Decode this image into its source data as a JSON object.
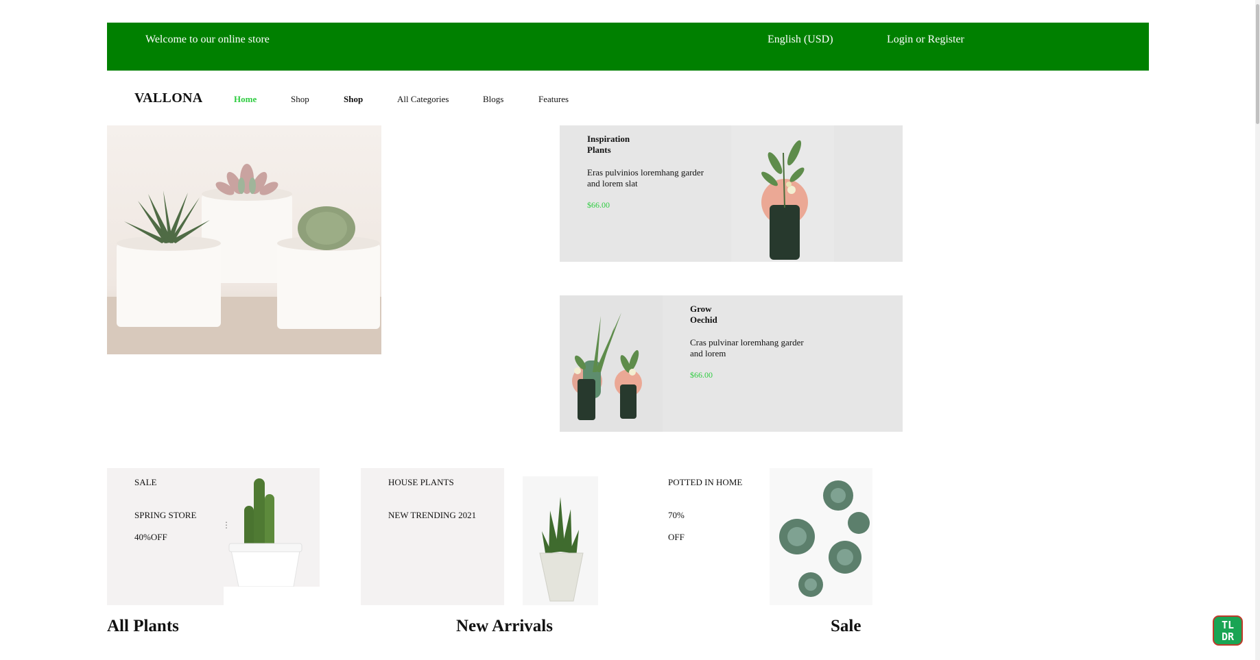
{
  "topbar": {
    "welcome": "Welcome to our online store",
    "language": "English (USD)",
    "login": "Login or Register",
    "color": "#008000"
  },
  "nav": {
    "logo": "VALLONA",
    "items": [
      {
        "label": "Home",
        "active": true
      },
      {
        "label": "Shop"
      },
      {
        "label": "Shop"
      },
      {
        "label": "All Categories"
      },
      {
        "label": "Blogs"
      },
      {
        "label": "Features"
      }
    ],
    "active_color": "#2ecc40"
  },
  "hero": {
    "image": "succulents-in-white-pots"
  },
  "promos": [
    {
      "title_line1": "Inspiration",
      "title_line2": "Plants",
      "desc_line1": "Eras pulvinios loremhang garder",
      "desc_line2": "and lorem slat",
      "price": "$66.00",
      "image": "plant-in-dark-vase"
    },
    {
      "title_line1": "Grow",
      "title_line2": "Oechid",
      "desc_line1": "Cras pulvinar loremhang garder",
      "desc_line2": "and lorem",
      "price": "$66.00",
      "image": "two-plants-in-vases"
    }
  ],
  "banners": [
    {
      "line1": "SALE",
      "line2": "SPRING STORE",
      "line3": "40%OFF",
      "image": "cactus-in-white-pot"
    },
    {
      "line1": "HOUSE PLANTS",
      "line2": "NEW TRENDING 2021",
      "image": "succulent-in-textured-pot"
    },
    {
      "line1": "POTTED IN HOME",
      "line2": "70%",
      "line3": "OFF",
      "image": "succulents-top-view"
    }
  ],
  "sections": {
    "all_plants": "All Plants",
    "new_arrivals": "New Arrivals",
    "sale": "Sale"
  },
  "widget": {
    "line1": "TL",
    "line2": "DR"
  }
}
